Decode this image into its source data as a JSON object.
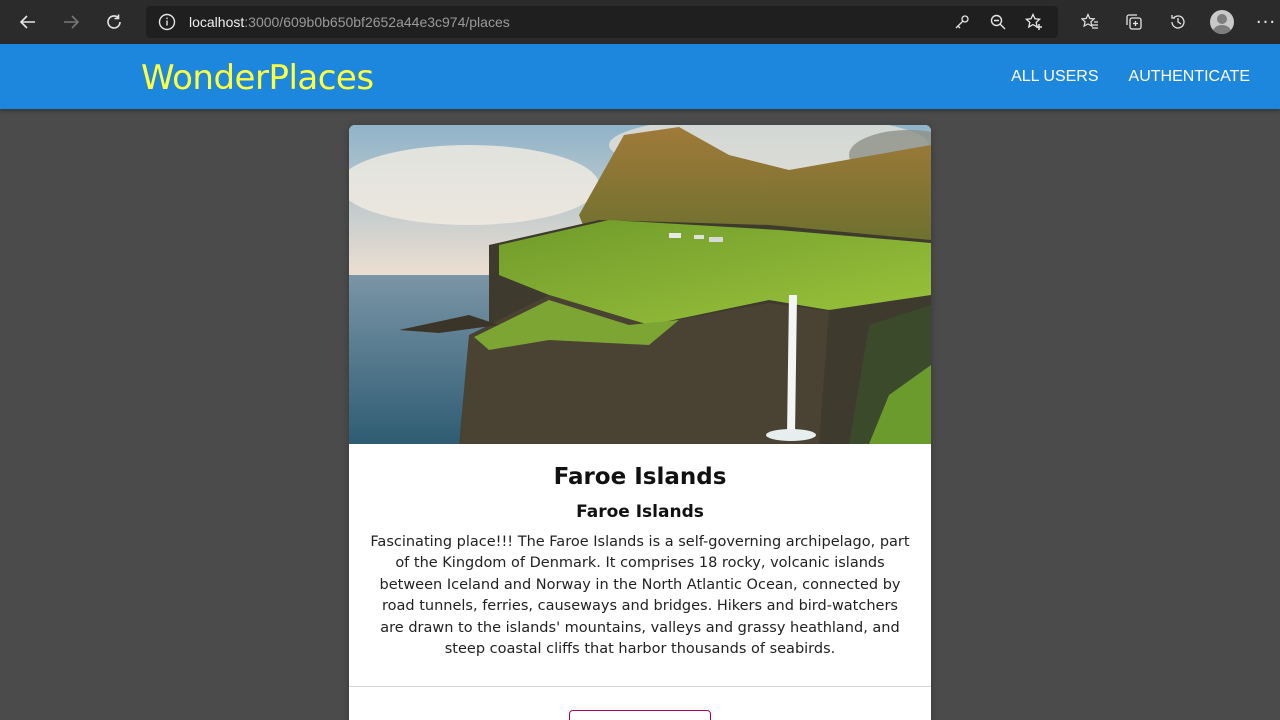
{
  "browser": {
    "url_host": "localhost",
    "url_path": ":3000/609b0b650bf2652a44e3c974/places"
  },
  "app": {
    "logo": "WonderPlaces",
    "nav": [
      "ALL USERS",
      "AUTHENTICATE"
    ]
  },
  "place": {
    "title": "Faroe Islands",
    "address": "Faroe Islands",
    "description": "Fascinating place!!! The Faroe Islands is a self-governing archipelago, part of the Kingdom of Denmark. It comprises 18 rocky, volcanic islands between Iceland and Norway in the North Atlantic Ocean, connected by road tunnels, ferries, causeways and bridges. Hikers and bird-watchers are drawn to the islands' mountains, valleys and grassy heathland, and steep coastal cliffs that harbor thousands of seabirds."
  },
  "colors": {
    "header": "#1d87de",
    "logo": "#ffff40",
    "background": "#4b4b4b",
    "button_border": "#ad005f"
  }
}
